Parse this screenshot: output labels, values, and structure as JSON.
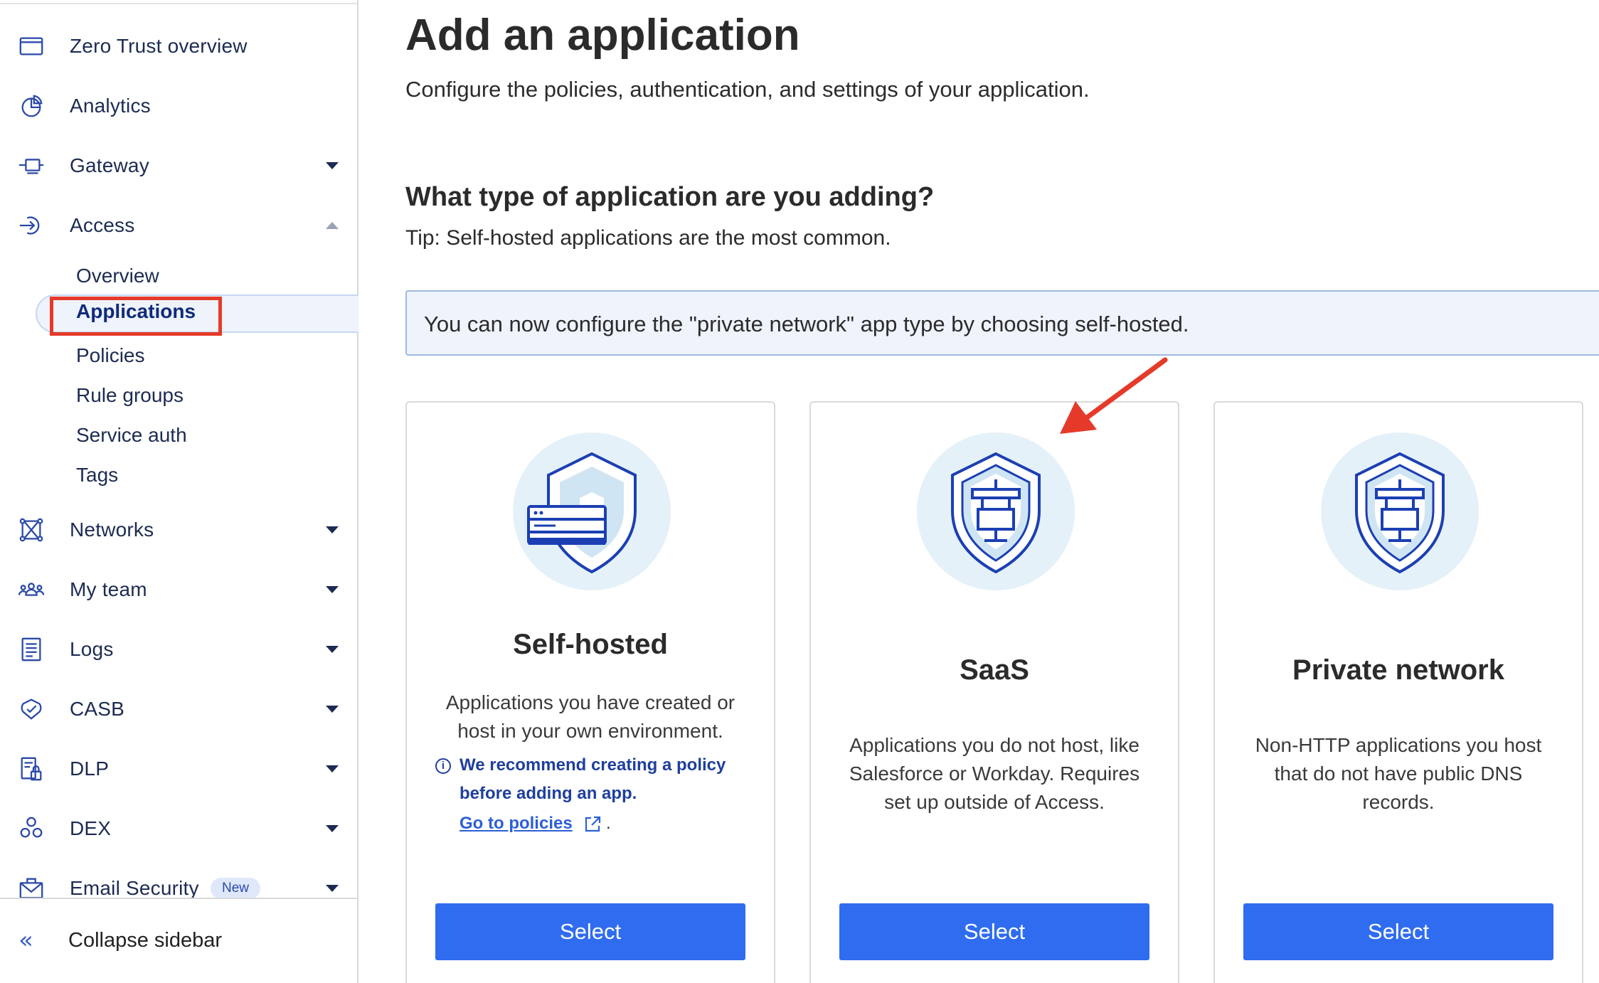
{
  "sidebar": {
    "items": [
      {
        "label": "Zero Trust overview",
        "icon": "browser-window-icon"
      },
      {
        "label": "Analytics",
        "icon": "pie-chart-icon"
      },
      {
        "label": "Gateway",
        "icon": "gateway-icon",
        "has_caret": true
      },
      {
        "label": "Access",
        "icon": "access-icon",
        "expanded": true
      },
      {
        "label": "Networks",
        "icon": "network-icon",
        "has_caret": true
      },
      {
        "label": "My team",
        "icon": "team-icon",
        "has_caret": true
      },
      {
        "label": "Logs",
        "icon": "logs-icon",
        "has_caret": true
      },
      {
        "label": "CASB",
        "icon": "casb-icon",
        "has_caret": true
      },
      {
        "label": "DLP",
        "icon": "dlp-icon",
        "has_caret": true
      },
      {
        "label": "DEX",
        "icon": "dex-icon",
        "has_caret": true
      },
      {
        "label": "Email Security",
        "icon": "email-security-icon",
        "has_caret": true,
        "badge": "New"
      }
    ],
    "access_sub": [
      "Overview",
      "Applications",
      "Policies",
      "Rule groups",
      "Service auth",
      "Tags"
    ],
    "active_sub": "Applications",
    "collapse_label": "Collapse sidebar"
  },
  "main": {
    "title": "Add an application",
    "subtitle": "Configure the policies, authentication, and settings of your application.",
    "question": "What type of application are you adding?",
    "tip": "Tip: Self-hosted applications are the most common.",
    "banner": "You can now configure the \"private network\" app type by choosing self-hosted.",
    "cards": [
      {
        "title": "Self-hosted",
        "description": "Applications you have created or host in your own environment.",
        "note": "We recommend creating a policy before adding an app.",
        "link": "Go to policies",
        "button": "Select"
      },
      {
        "title": "SaaS",
        "description": "Applications you do not host, like Salesforce or Workday. Requires set up outside of Access.",
        "button": "Select"
      },
      {
        "title": "Private network",
        "description": "Non-HTTP applications you host that do not have public DNS records.",
        "button": "Select"
      }
    ]
  },
  "colors": {
    "primary": "#2f6cf0",
    "highlight": "#e53a2a",
    "banner_bg": "#eef3fc",
    "illustration_bg": "#e5f1f9"
  }
}
